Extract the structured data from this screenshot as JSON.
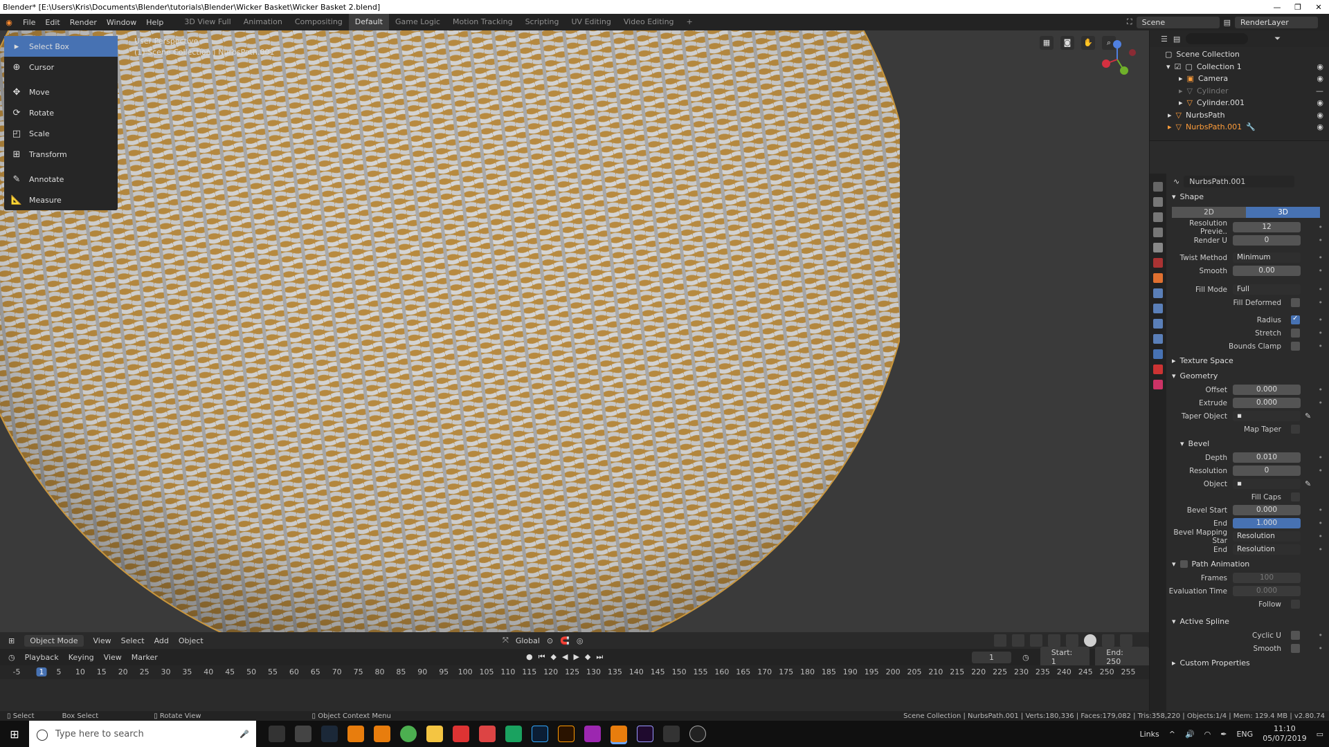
{
  "window": {
    "title": "Blender* [E:\\Users\\Kris\\Documents\\Blender\\tutorials\\Blender\\Wicker Basket\\Wicker Basket 2.blend]"
  },
  "menu": [
    "File",
    "Edit",
    "Render",
    "Window",
    "Help"
  ],
  "workspaces": [
    "3D View Full",
    "Animation",
    "Compositing",
    "Default",
    "Game Logic",
    "Motion Tracking",
    "Scripting",
    "UV Editing",
    "Video Editing"
  ],
  "active_workspace": "Default",
  "add_workspace": "+",
  "scene": {
    "name": "Scene",
    "render_layer": "RenderLayer"
  },
  "tools": [
    {
      "label": "Select Box",
      "icon": "select-box-icon"
    },
    {
      "label": "Cursor",
      "icon": "cursor-icon"
    },
    {
      "label": "Move",
      "icon": "move-icon"
    },
    {
      "label": "Rotate",
      "icon": "rotate-icon"
    },
    {
      "label": "Scale",
      "icon": "scale-icon"
    },
    {
      "label": "Transform",
      "icon": "transform-icon"
    },
    {
      "label": "Annotate",
      "icon": "annotate-icon"
    },
    {
      "label": "Measure",
      "icon": "measure-icon"
    }
  ],
  "viewport": {
    "perspective": "User Perspective",
    "context": "(1) Scene Collection | NurbsPath.001"
  },
  "viewport_header": {
    "mode": "Object Mode",
    "menus": [
      "View",
      "Select",
      "Add",
      "Object"
    ],
    "orientation": "Global"
  },
  "timeline": {
    "menus": [
      "Playback",
      "Keying",
      "View",
      "Marker"
    ],
    "current_frame": "1",
    "start_label": "Start:",
    "start": "1",
    "end_label": "End:",
    "end": "250",
    "ticks": [
      "-5",
      "1",
      "5",
      "10",
      "15",
      "20",
      "25",
      "30",
      "35",
      "40",
      "45",
      "50",
      "55",
      "60",
      "65",
      "70",
      "75",
      "80",
      "85",
      "90",
      "95",
      "100",
      "105",
      "110",
      "115",
      "120",
      "125",
      "130",
      "135",
      "140",
      "145",
      "150",
      "155",
      "160",
      "165",
      "170",
      "175",
      "180",
      "185",
      "190",
      "195",
      "200",
      "205",
      "210",
      "215",
      "220",
      "225",
      "230",
      "235",
      "240",
      "245",
      "250",
      "255"
    ]
  },
  "status": {
    "select": "Select",
    "box_select": "Box Select",
    "rotate_view": "Rotate View",
    "context_menu": "Object Context Menu",
    "stats": "Scene Collection | NurbsPath.001 | Verts:180,336 | Faces:179,082 | Tris:358,220 | Objects:1/4 | Mem: 129.4 MB | v2.80.74"
  },
  "outliner": {
    "root": "Scene Collection",
    "items": [
      {
        "label": "Collection 1",
        "state": "normal"
      },
      {
        "label": "Camera",
        "state": "normal"
      },
      {
        "label": "Cylinder",
        "state": "dim"
      },
      {
        "label": "Cylinder.001",
        "state": "normal"
      },
      {
        "label": "NurbsPath",
        "state": "normal"
      },
      {
        "label": "NurbsPath.001",
        "state": "selected"
      }
    ]
  },
  "properties": {
    "object": "NurbsPath.001",
    "data": "NurbsPath.001",
    "datablock": "NurbsPath.001",
    "shape": {
      "title": "Shape",
      "mode_2d": "2D",
      "mode_3d": "3D",
      "resolution_preview_label": "Resolution Previe..",
      "resolution_preview": "12",
      "render_u_label": "Render U",
      "render_u": "0",
      "twist_method_label": "Twist Method",
      "twist_method": "Minimum",
      "smooth_label": "Smooth",
      "smooth": "0.00",
      "fill_mode_label": "Fill Mode",
      "fill_mode": "Full",
      "fill_deformed_label": "Fill Deformed",
      "radius_label": "Radius",
      "stretch_label": "Stretch",
      "bounds_clamp_label": "Bounds Clamp"
    },
    "texture_space": "Texture Space",
    "geometry": {
      "title": "Geometry",
      "offset_label": "Offset",
      "offset": "0.000",
      "extrude_label": "Extrude",
      "extrude": "0.000",
      "taper_label": "Taper Object",
      "map_taper_label": "Map Taper"
    },
    "bevel": {
      "title": "Bevel",
      "depth_label": "Depth",
      "depth": "0.010",
      "resolution_label": "Resolution",
      "resolution": "0",
      "object_label": "Object",
      "fill_caps_label": "Fill Caps",
      "bevel_start_label": "Bevel Start",
      "bevel_start": "0.000",
      "end_label": "End",
      "end": "1.000",
      "mapping_start_label": "Bevel Mapping Star",
      "mapping_start": "Resolution",
      "mapping_end_label": "End",
      "mapping_end": "Resolution"
    },
    "path_animation": {
      "title": "Path Animation",
      "frames_label": "Frames",
      "frames": "100",
      "eval_label": "Evaluation Time",
      "eval": "0.000",
      "follow_label": "Follow"
    },
    "active_spline": {
      "title": "Active Spline",
      "cyclic_u_label": "Cyclic U",
      "smooth_label": "Smooth"
    },
    "custom_properties": "Custom Properties"
  },
  "taskbar": {
    "search_placeholder": "Type here to search",
    "links": "Links",
    "lang": "ENG",
    "time": "11:10",
    "date": "05/07/2019"
  },
  "colors": {
    "accent": "#4772b3",
    "selected": "#ff9d3a",
    "wicker_light": "#cfcfcf",
    "wicker_gap": "#c8963e"
  }
}
